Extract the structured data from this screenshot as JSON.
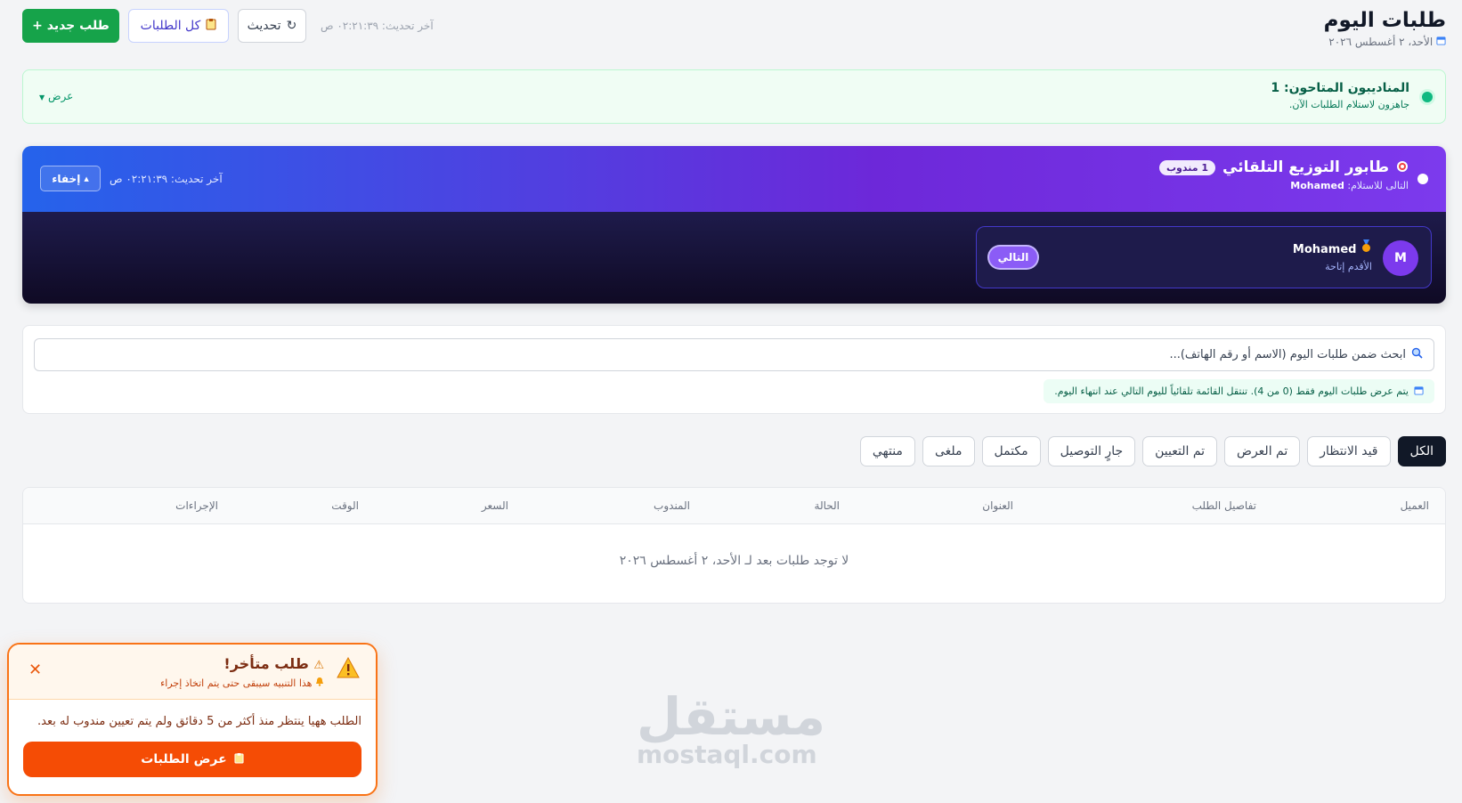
{
  "header": {
    "title": "طلبات اليوم",
    "date_icon": "calendar-icon",
    "date": "الأحد، ٢ أغسطس ٢٠٢٦",
    "new_order": "+ طلب جديد",
    "all_orders": "كل الطلبات",
    "refresh": "تحديث",
    "last_update": "آخر تحديث: ٠٢:٢١:٣٩ ص"
  },
  "available_reps": {
    "title": "المناديبون المتاحون: 1",
    "subtitle": "جاهزون لاستلام الطلبات الآن.",
    "view": "عرض"
  },
  "queue": {
    "title": "طابور التوزيع التلقائي",
    "badge": "1 مندوب",
    "next_label": "التالى للاستلام:",
    "next_name": "Mohamed",
    "last_update": "آخر تحديث: ٠٢:٢١:٣٩ ص",
    "hide": "إخفاء",
    "rep": {
      "avatar": "M",
      "name": "Mohamed",
      "sub": "الأقدم إتاحة",
      "next_badge": "التالي"
    }
  },
  "search": {
    "placeholder": "ابحث ضمن طلبات اليوم (الاسم أو رقم الهاتف)...",
    "info": "يتم عرض طلبات اليوم فقط (0 من 4). تنتقل القائمة تلقائياً لليوم التالي عند انتهاء اليوم."
  },
  "tabs": [
    "الكل",
    "قيد الانتظار",
    "تم العرض",
    "تم التعيين",
    "جارٍ التوصيل",
    "مكتمل",
    "ملغى",
    "منتهي"
  ],
  "table": {
    "columns": [
      "العميل",
      "تفاصيل الطلب",
      "العنوان",
      "الحالة",
      "المندوب",
      "السعر",
      "الوقت",
      "الإجراءات"
    ],
    "empty": "لا توجد طلبات بعد لـ الأحد، ٢ أغسطس ٢٠٢٦"
  },
  "toast": {
    "title": "طلب متأخر!",
    "subtitle": "هذا التنبيه سيبقى حتى يتم اتخاذ إجراء",
    "message": "الطلب  ههيا ينتظر منذ أكثر من 5 دقائق ولم يتم تعيين مندوب له بعد.",
    "button": "عرض الطلبات"
  },
  "watermark": {
    "ar": "مستقل",
    "en": "mostaql.com"
  },
  "colors": {
    "primary_green": "#16a34a",
    "queue_gradient_start": "#2563eb",
    "queue_gradient_end": "#7c3aed",
    "toast_orange": "#f54c05",
    "active_tab": "#111827"
  }
}
